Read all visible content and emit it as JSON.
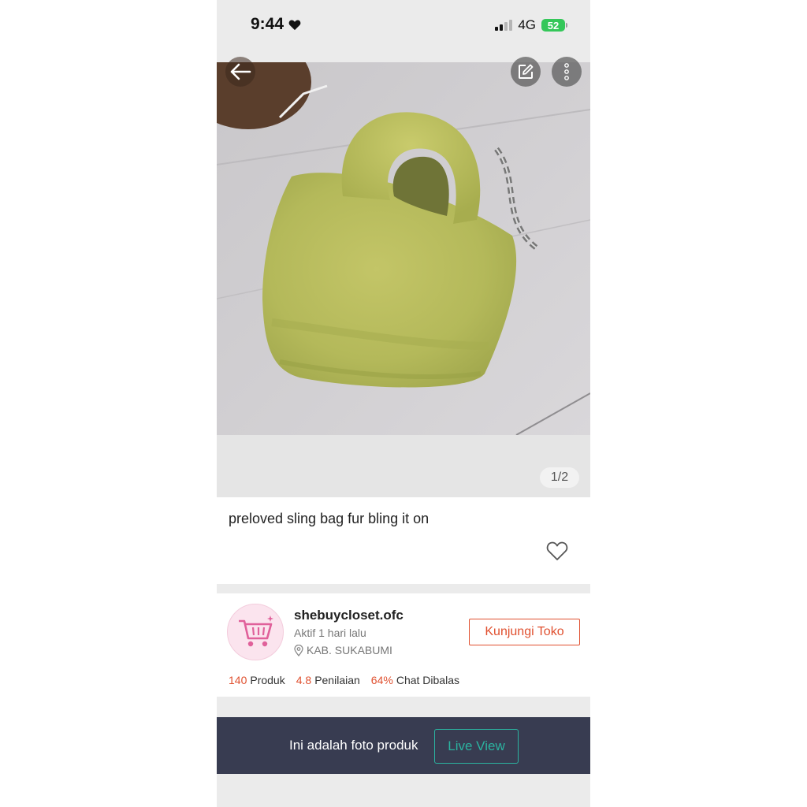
{
  "status_bar": {
    "time": "9:44",
    "network": "4G",
    "battery": "52",
    "battery_color": "#34c759"
  },
  "photo": {
    "counter": "1/2"
  },
  "product": {
    "title": "preloved sling bag fur bling it on"
  },
  "shop": {
    "name": "shebuycloset.ofc",
    "active": "Aktif 1 hari lalu",
    "location": "KAB. SUKABUMI",
    "visit_label": "Kunjungi Toko",
    "stats": [
      {
        "value": "140",
        "label": "Produk"
      },
      {
        "value": "4.8",
        "label": "Penilaian"
      },
      {
        "value": "64%",
        "label": "Chat Dibalas"
      }
    ],
    "accent_color": "#e0502f"
  },
  "live_banner": {
    "text": "Ini adalah foto produk",
    "button_label": "Live View",
    "background": "#383c51",
    "button_color": "#2bb3a0"
  },
  "icons": [
    "heart-icon",
    "signal-icon",
    "battery-icon",
    "back-arrow-icon",
    "edit-icon",
    "more-vertical-icon",
    "favorite-heart-icon",
    "shopping-cart-icon",
    "location-pin-icon"
  ]
}
